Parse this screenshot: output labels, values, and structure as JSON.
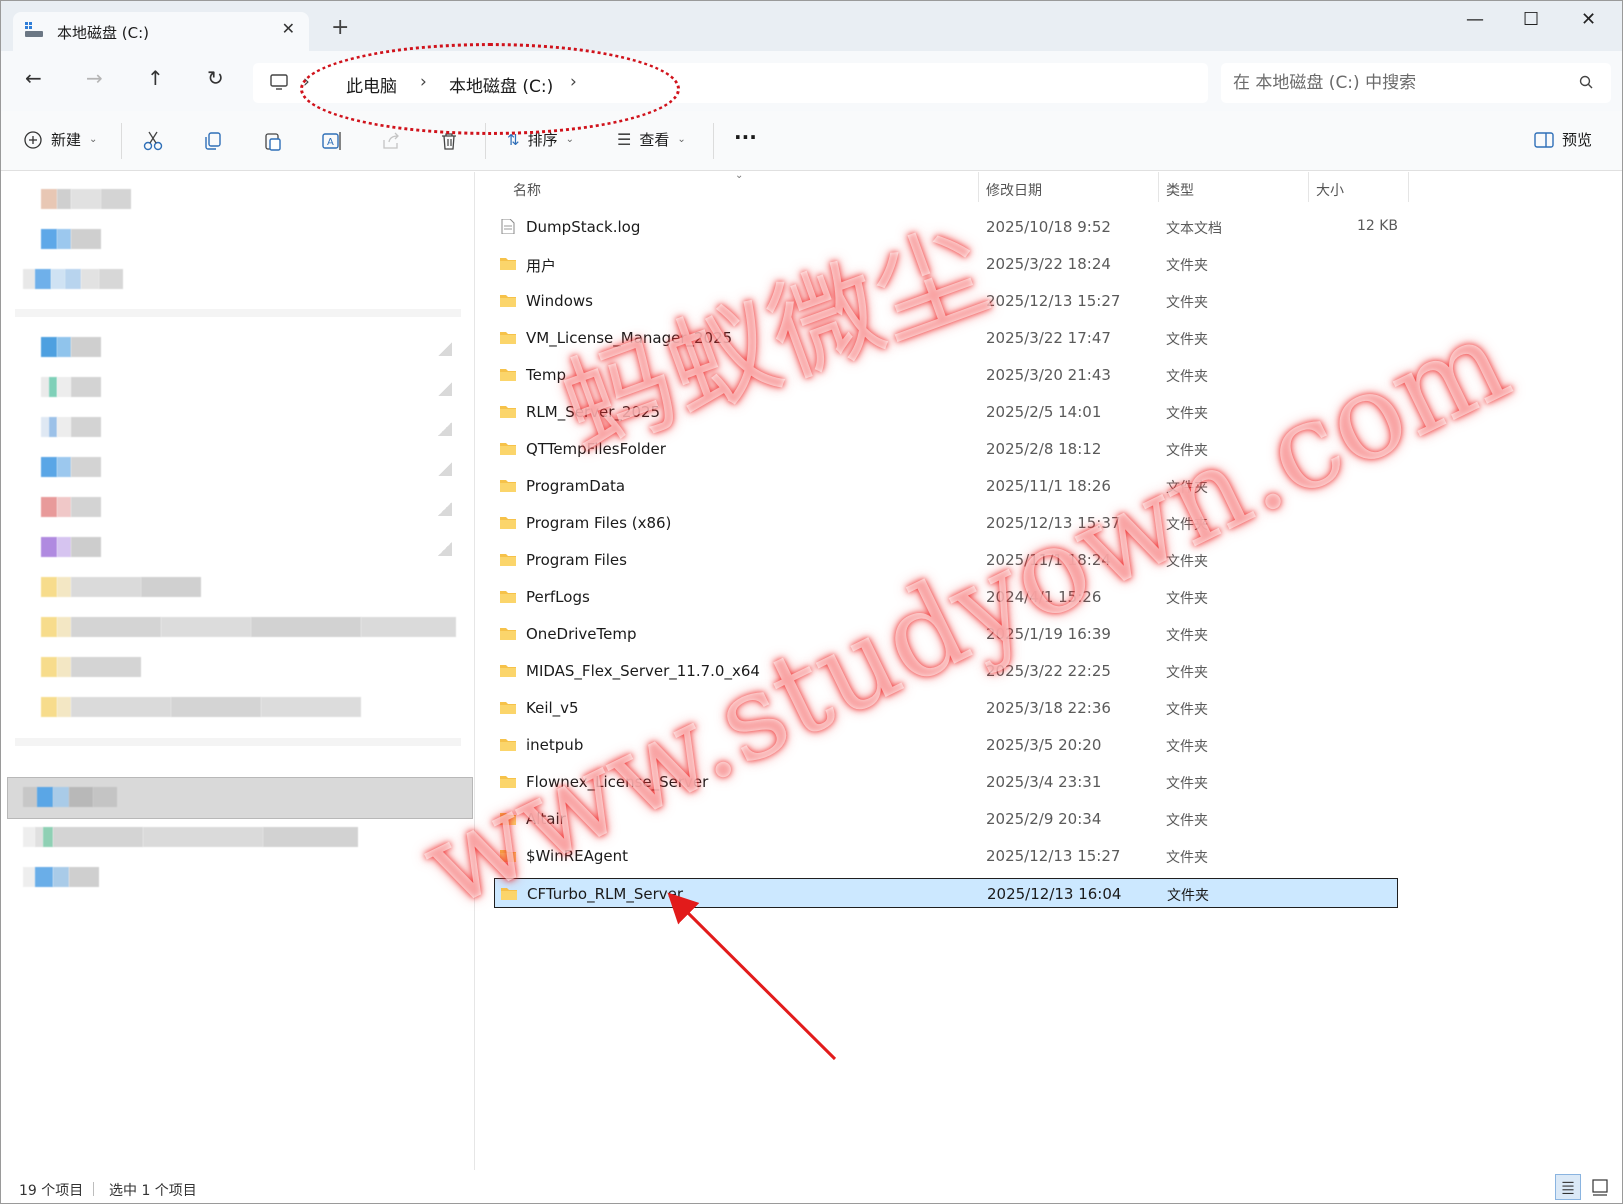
{
  "window": {
    "tab_title": "本地磁盘 (C:)",
    "new_tab_symbol": "+",
    "close_tab_symbol": "✕",
    "minimize_symbol": "—",
    "maximize_symbol": "☐",
    "close_symbol": "✕"
  },
  "nav": {
    "back_icon": "←",
    "forward_icon": "→",
    "up_icon": "↑",
    "refresh_icon": "↻",
    "breadcrumb": [
      "此电脑",
      "本地磁盘 (C:)"
    ],
    "search_placeholder": "在 本地磁盘 (C:) 中搜索"
  },
  "toolbar": {
    "new_label": "新建",
    "sort_label": "排序",
    "view_label": "查看",
    "more_label": "···",
    "preview_label": "预览"
  },
  "columns": {
    "name": "名称",
    "modified": "修改日期",
    "type": "类型",
    "size": "大小"
  },
  "files": [
    {
      "name": "DumpStack.log",
      "date": "2025/10/18 9:52",
      "type": "文本文档",
      "size": "12 KB",
      "icon": "text-file-icon"
    },
    {
      "name": "用户",
      "date": "2025/3/22 18:24",
      "type": "文件夹",
      "size": "",
      "icon": "folder-icon"
    },
    {
      "name": "Windows",
      "date": "2025/12/13 15:27",
      "type": "文件夹",
      "size": "",
      "icon": "folder-icon"
    },
    {
      "name": "VM_License_Manager_2025",
      "date": "2025/3/22 17:47",
      "type": "文件夹",
      "size": "",
      "icon": "folder-icon"
    },
    {
      "name": "Temp",
      "date": "2025/3/20 21:43",
      "type": "文件夹",
      "size": "",
      "icon": "folder-icon"
    },
    {
      "name": "RLM_Server_2025",
      "date": "2025/2/5 14:01",
      "type": "文件夹",
      "size": "",
      "icon": "folder-icon"
    },
    {
      "name": "QTTempFilesFolder",
      "date": "2025/2/8 18:12",
      "type": "文件夹",
      "size": "",
      "icon": "folder-icon"
    },
    {
      "name": "ProgramData",
      "date": "2025/11/1 18:26",
      "type": "文件夹",
      "size": "",
      "icon": "folder-icon"
    },
    {
      "name": "Program Files (x86)",
      "date": "2025/12/13 15:37",
      "type": "文件夹",
      "size": "",
      "icon": "folder-icon"
    },
    {
      "name": "Program Files",
      "date": "2025/11/1 18:24",
      "type": "文件夹",
      "size": "",
      "icon": "folder-icon"
    },
    {
      "name": "PerfLogs",
      "date": "2024/4/1 15:26",
      "type": "文件夹",
      "size": "",
      "icon": "folder-icon"
    },
    {
      "name": "OneDriveTemp",
      "date": "2025/1/19 16:39",
      "type": "文件夹",
      "size": "",
      "icon": "folder-icon"
    },
    {
      "name": "MIDAS_Flex_Server_11.7.0_x64",
      "date": "2025/3/22 22:25",
      "type": "文件夹",
      "size": "",
      "icon": "folder-icon"
    },
    {
      "name": "Keil_v5",
      "date": "2025/3/18 22:36",
      "type": "文件夹",
      "size": "",
      "icon": "folder-icon"
    },
    {
      "name": "inetpub",
      "date": "2025/3/5 20:20",
      "type": "文件夹",
      "size": "",
      "icon": "folder-icon"
    },
    {
      "name": "Flownex_License_Server",
      "date": "2025/3/4 23:31",
      "type": "文件夹",
      "size": "",
      "icon": "folder-icon"
    },
    {
      "name": "Altair",
      "date": "2025/2/9 20:34",
      "type": "文件夹",
      "size": "",
      "icon": "folder-icon"
    },
    {
      "name": "$WinREAgent",
      "date": "2025/12/13 15:27",
      "type": "文件夹",
      "size": "",
      "icon": "folder-icon"
    },
    {
      "name": "CFTurbo_RLM_Server",
      "date": "2025/12/13 16:04",
      "type": "文件夹",
      "size": "",
      "icon": "folder-icon",
      "selected": true
    }
  ],
  "status": {
    "item_count": "19 个项目",
    "selected_count": "选中 1 个项目"
  },
  "watermark": {
    "line1": "蚂蚁微尘",
    "line2": "www.studyown.com"
  },
  "colors": {
    "selection": "#cce8ff",
    "folder": "#f6c24a",
    "annotation": "#d0121b"
  }
}
